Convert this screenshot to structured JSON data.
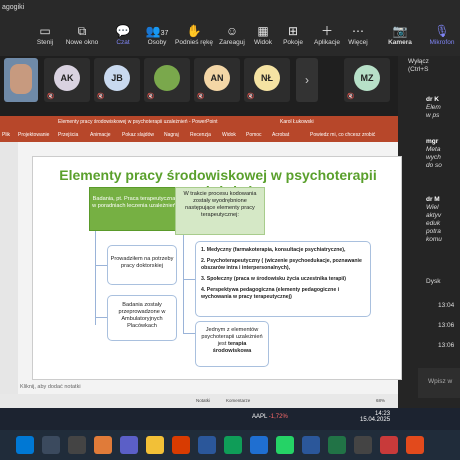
{
  "teams": {
    "title": "agogiki",
    "toolbar": [
      {
        "label": "Stenij",
        "icon": "stop-icon"
      },
      {
        "label": "Nowe okno",
        "icon": "window-icon"
      },
      {
        "label": "Czat",
        "icon": "chat-icon"
      },
      {
        "label": "Osoby",
        "count": "37",
        "icon": "people-icon"
      },
      {
        "label": "Podnieś rękę",
        "icon": "hand-icon"
      },
      {
        "label": "Zareaguj",
        "icon": "react-icon"
      },
      {
        "label": "Widok",
        "icon": "view-icon"
      },
      {
        "label": "Pokoje",
        "icon": "rooms-icon"
      },
      {
        "label": "Aplikacje",
        "icon": "apps-icon"
      },
      {
        "label": "Więcej",
        "icon": "more-icon"
      },
      {
        "label": "Kamera",
        "icon": "camera-icon"
      },
      {
        "label": "Mikrofon",
        "icon": "mic-icon"
      }
    ],
    "participants": [
      {
        "initials": "",
        "color": "#7aa2c9"
      },
      {
        "initials": "AK",
        "color": "#d9d2e0"
      },
      {
        "initials": "JB",
        "color": "#c9d9ef"
      },
      {
        "initials": "",
        "color": "#7aa84c"
      },
      {
        "initials": "AN",
        "color": "#f3d6a6"
      },
      {
        "initials": "NŁ",
        "color": "#f5e3a3"
      },
      {
        "initials": "MZ",
        "color": "#b7e0c8"
      }
    ],
    "next_arrow": "›"
  },
  "chat": {
    "mute_hint_1": "Wyłącz",
    "mute_hint_2": "(Ctrl+S",
    "messages": [
      {
        "name": "dr K",
        "lines": [
          "Elem",
          "w ps"
        ]
      },
      {
        "name": "mgr",
        "lines": [
          "Meta",
          "wych",
          "do so"
        ]
      },
      {
        "name": "dr M",
        "lines": [
          "Wiel",
          "aktyv",
          "eduk",
          "potra",
          "komu"
        ]
      },
      {
        "name": "Dysk",
        "lines": []
      }
    ],
    "times": [
      "13:04",
      "13:06",
      "13:06"
    ],
    "input_placeholder": "Wpisz w"
  },
  "ppt": {
    "window_title": "Elementy pracy środowiskowej w psychoterapii uzależnień - PowerPoint",
    "user": "Karol Łukowski",
    "menu": [
      "Plik",
      "Projektowanie",
      "Przejścia",
      "Animacje",
      "Pokaz slajdów",
      "Nagraj",
      "Recenzja",
      "Widok",
      "Pomoc",
      "Acrobat",
      "Powiedz mi, co chcesz zrobić"
    ],
    "notes_placeholder": "Kliknij, aby dodać notatki",
    "status": [
      "Notatki",
      "Komentarze",
      "68%"
    ]
  },
  "slide": {
    "title": "Elementy pracy środowiskowej w psychoterapii uzależnień",
    "left_head": "Badania, pt. Praca terapeutyczna w poradniach leczenia uzależnień",
    "left_box1": "Prowadziłem na potrzeby pracy doktorskiej",
    "left_box2": "Badania zostały przeprowadzone w Ambulatoryjnych Placówkach",
    "right_head": "W trakcie procesu kodowania zostały wyodrębnione następujące elementy pracy terapeutycznej:",
    "items": [
      "1. Medyczny (farmakoterapia, konsultacje psychiatryczne),",
      "2. Psychoterapeutyczny ( (wiczenie psychoedukacje, poznawanie obszarów intra i interpersonalnych),",
      "3. Społeczny (praca w środowisku życia uczestnika terapii)",
      "4. Perspektywa pedagogiczna (elementy pedagogiczne i wychowania w pracy terapeutycznej)"
    ],
    "right_box2_a": "Jednym z elementów psychoterapii uzależnień jest",
    "right_box2_b": "terapia środowiskowa"
  },
  "taskbar": {
    "stock": "AAPL",
    "change": "-1,72%",
    "time": "14:23",
    "date": "15.04.2025"
  }
}
